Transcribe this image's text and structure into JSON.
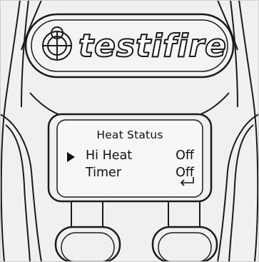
{
  "brand": {
    "name": "testifire"
  },
  "screen": {
    "title": "Heat Status",
    "rows": [
      {
        "label": "Hi Heat",
        "value": "Off",
        "selected": true
      },
      {
        "label": "Timer",
        "value": "Off",
        "selected": false
      }
    ],
    "enter_icon": "enter-return-icon"
  },
  "colors": {
    "outline": "#1a1a1a",
    "body": "#f0f0f0",
    "display": "#f7f7f7",
    "background": "#ffffff"
  }
}
